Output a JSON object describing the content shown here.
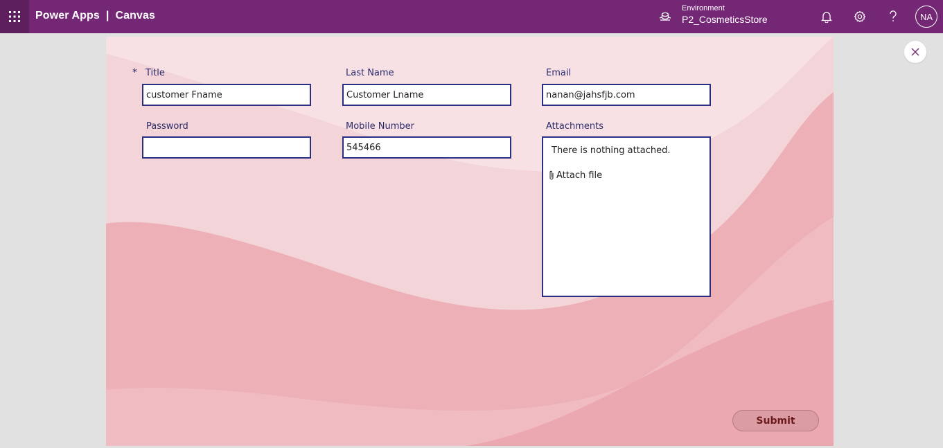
{
  "header": {
    "app_name": "Power Apps",
    "separator": "|",
    "section": "Canvas",
    "environment_label": "Environment",
    "environment_value": "P2_CosmeticsStore",
    "avatar_initials": "NA",
    "icons": [
      "waffle-icon",
      "environment-icon",
      "bell-icon",
      "gear-icon",
      "help-icon"
    ]
  },
  "form": {
    "title": {
      "label": "Title",
      "required_marker": "*",
      "value": "customer Fname"
    },
    "last_name": {
      "label": "Last Name",
      "value": "Customer Lname"
    },
    "email": {
      "label": "Email",
      "value": "nanan@jahsfjb.com"
    },
    "password": {
      "label": "Password",
      "value": ""
    },
    "mobile": {
      "label": "Mobile Number",
      "value": "545466"
    },
    "attachments": {
      "label": "Attachments",
      "empty_text": "There is nothing attached.",
      "attach_label": "Attach file"
    }
  },
  "submit_label": "Submit",
  "colors": {
    "header_bg": "#742774",
    "canvas_bg": "#f0c3c8",
    "field_border": "#2b2f82",
    "submit_bg": "#dc9ca3"
  }
}
